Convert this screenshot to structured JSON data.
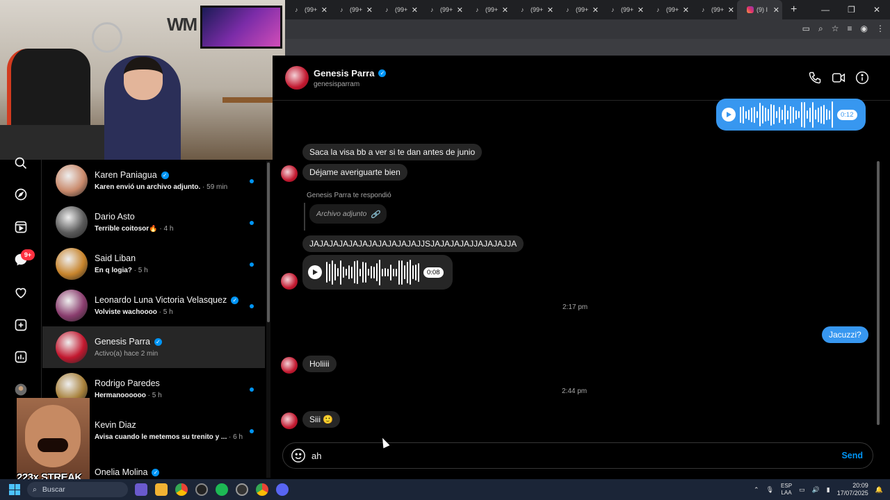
{
  "browser": {
    "tabs": [
      {
        "label": "(99+",
        "active": false
      },
      {
        "label": "(99+",
        "active": false
      },
      {
        "label": "(99+",
        "active": false
      },
      {
        "label": "(99+",
        "active": false
      },
      {
        "label": "(99+",
        "active": false
      },
      {
        "label": "(99+",
        "active": false
      },
      {
        "label": "(99+",
        "active": false
      },
      {
        "label": "(99+",
        "active": false
      },
      {
        "label": "(99+",
        "active": false
      },
      {
        "label": "(99+",
        "active": false
      },
      {
        "label": "(9) I",
        "active": true
      }
    ]
  },
  "rail": {
    "messages_badge": "9+"
  },
  "conversations": [
    {
      "name": "Karen Paniagua",
      "verified": true,
      "preview": "Karen envió un archivo adjunto.",
      "time": "59 min",
      "unread": true,
      "avatar_color": "#c98a6c"
    },
    {
      "name": "Dario Asto",
      "verified": false,
      "preview": "Terrible coitosor🔥",
      "time": "4 h",
      "unread": true,
      "avatar_color": "#5a5a5a"
    },
    {
      "name": "Said Liban",
      "verified": false,
      "preview": "En q logia?",
      "time": "5 h",
      "unread": true,
      "avatar_color": "#c7842c"
    },
    {
      "name": "Leonardo Luna Victoria Velasquez",
      "verified": true,
      "preview": "Volviste wachoooo",
      "time": "5 h",
      "unread": true,
      "avatar_color": "#8a3d6e"
    },
    {
      "name": "Genesis Parra",
      "verified": true,
      "preview": "Activo(a) hace 2 min",
      "time": "",
      "unread": false,
      "active": true,
      "avatar_color": "#c2182f"
    },
    {
      "name": "Rodrigo Paredes",
      "verified": false,
      "preview": "Hermanoooooo",
      "time": "5 h",
      "unread": true,
      "avatar_color": "#a8813b"
    },
    {
      "name": "Kevin Diaz",
      "verified": false,
      "preview": "Avisa cuando le metemos su trenito y ...",
      "time": "6 h",
      "unread": true,
      "avatar_color": "#6f5a3c"
    },
    {
      "name": "Onelia Molina",
      "verified": true,
      "preview": "",
      "time": "",
      "unread": false,
      "avatar_color": "#b77a9a"
    }
  ],
  "overlay": {
    "streak_text": "223x STREAK"
  },
  "chat": {
    "name": "Genesis Parra",
    "username": "genesisparram",
    "messages": {
      "voice_out_duration": "0:12",
      "msg1": "Saca la visa bb a ver si te dan antes de junio",
      "msg2": "Déjame averiguarte bien",
      "reply_label": "Genesis Parra te respondió",
      "reply_content": "Archivo adjunto",
      "msg3": "JAJAJAJAJAJAJAJAJAJAJAJJSJAJAJAJAJJAJAJAJJA",
      "voice_in_duration": "0:08",
      "time1": "2:17 pm",
      "msg_out": "Jacuzzi?",
      "msg4": "Holiiii",
      "time2": "2:44 pm",
      "msg5": "Siii 🙂"
    },
    "composer": {
      "value": "ah",
      "send_label": "Send"
    }
  },
  "taskbar": {
    "search_placeholder": "Buscar",
    "lang_top": "ESP",
    "lang_bottom": "LAA",
    "time": "20:09",
    "date": "17/07/2025"
  },
  "colors": {
    "accent": "#0095f6",
    "out_bubble": "#3797f0",
    "in_bubble": "#262626"
  }
}
